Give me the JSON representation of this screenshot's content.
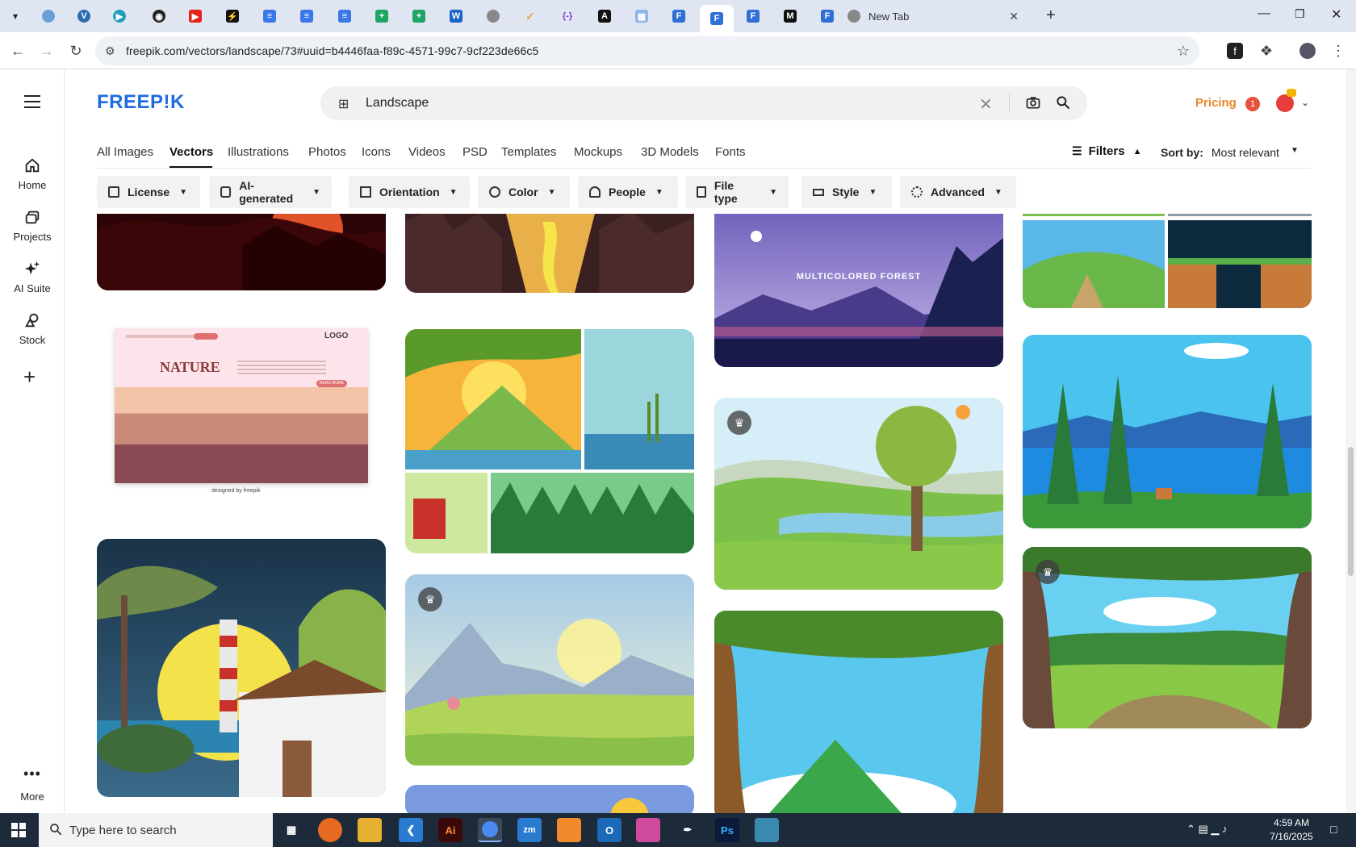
{
  "browser": {
    "new_tab_title": "New Tab",
    "url": "freepik.com/vectors/landscape/73#uuid=b4446faa-f89c-4571-99c7-9cf223de66c5"
  },
  "rail": {
    "items": [
      {
        "label": "Home"
      },
      {
        "label": "Projects"
      },
      {
        "label": "AI Suite"
      },
      {
        "label": "Stock"
      },
      {
        "label": "More"
      }
    ]
  },
  "header": {
    "logo": "FREEP!K",
    "search_value": "Landscape",
    "pricing": "Pricing",
    "notification_count": "1"
  },
  "categories": [
    "All Images",
    "Vectors",
    "Illustrations",
    "Photos",
    "Icons",
    "Videos",
    "PSD",
    "Templates",
    "Mockups",
    "3D Models",
    "Fonts"
  ],
  "active_category": "Vectors",
  "filters_label": "Filters",
  "sort": {
    "label": "Sort by:",
    "value": "Most relevant"
  },
  "chips": [
    "License",
    "AI-generated",
    "Orientation",
    "Color",
    "People",
    "File type",
    "Style",
    "Advanced"
  ],
  "cards": {
    "nature_title": "NATURE",
    "nature_logo": "LOGO",
    "nature_button": "READ MORE",
    "nature_credit": "designed by freepik",
    "forest_title": "MULTICOLORED FOREST"
  },
  "taskbar": {
    "search_placeholder": "Type here to search",
    "time": "4:59 AM",
    "date": "7/16/2025"
  }
}
